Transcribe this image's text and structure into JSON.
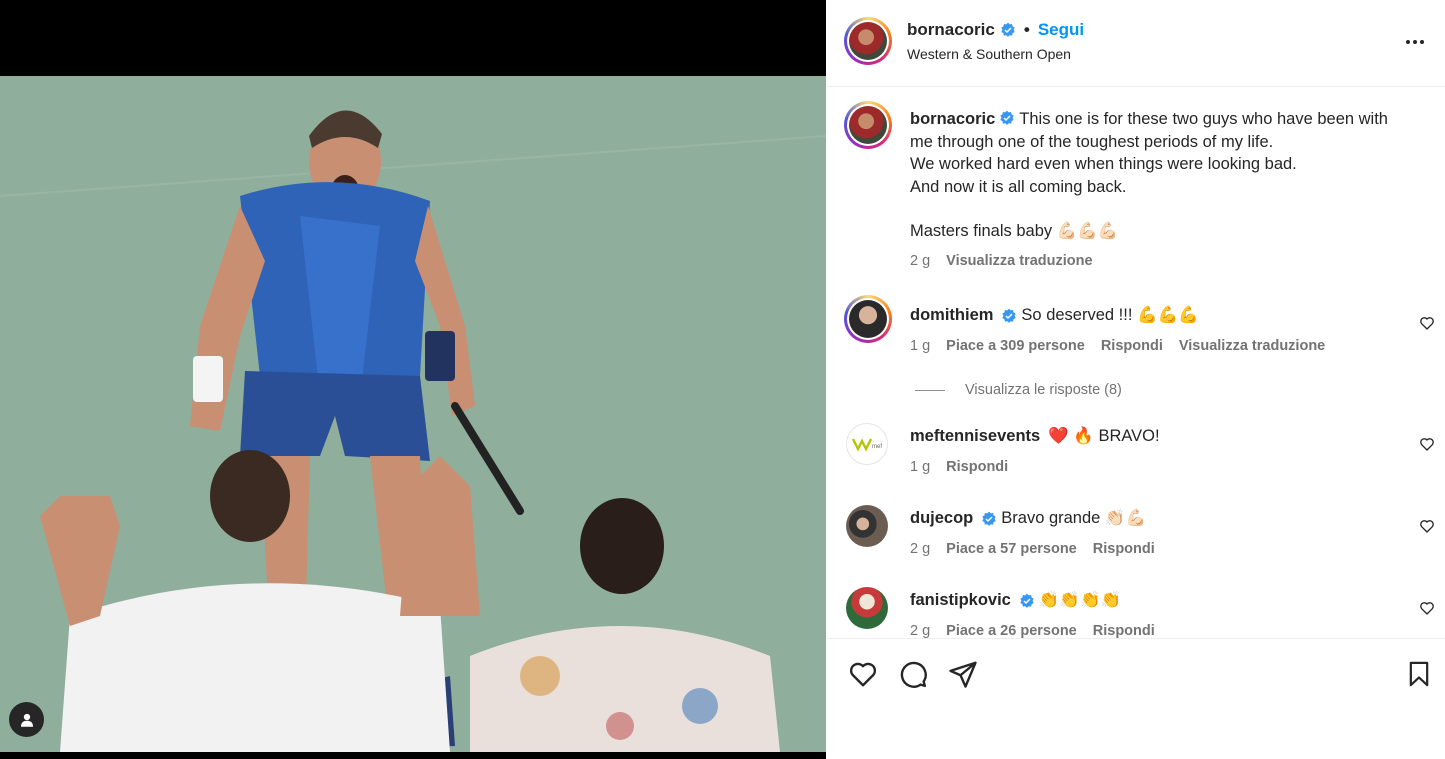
{
  "post": {
    "author": "bornacoric",
    "follow_label": "Segui",
    "separator": "•",
    "location": "Western & Southern Open"
  },
  "caption": {
    "username": "bornacoric",
    "line1": "This one is for these two guys who have been with",
    "line2": "me through one of the toughest periods of my life.",
    "line3": "We worked hard even when things were looking bad.",
    "line4": "And now it is all coming back.",
    "line5": "Masters finals baby 💪🏻💪🏻💪🏻",
    "time": "2 g",
    "translate_label": "Visualizza traduzione"
  },
  "comments": [
    {
      "username": "domithiem",
      "text": "So deserved !!! 💪💪💪",
      "time": "1 g",
      "likes": "Piace a 309 persone",
      "reply_label": "Rispondi",
      "translate_label": "Visualizza traduzione",
      "view_replies": "Visualizza le risposte (8)"
    },
    {
      "username": "meftennisevents",
      "text": "❤️ 🔥 BRAVO!",
      "time": "1 g",
      "reply_label": "Rispondi"
    },
    {
      "username": "dujecop",
      "text": "Bravo grande 👏🏻💪🏻",
      "time": "2 g",
      "likes": "Piace a 57 persone",
      "reply_label": "Rispondi"
    },
    {
      "username": "fanistipkovic",
      "text": "👏👏👏👏",
      "time": "2 g",
      "likes": "Piace a 26 persone",
      "reply_label": "Rispondi"
    }
  ],
  "icons": {
    "more": "more-horizontal-icon",
    "like": "heart-icon",
    "comment": "comment-icon",
    "share": "share-icon",
    "save": "bookmark-icon",
    "user_tag": "user-tag-icon",
    "verified": "verified-badge-icon"
  },
  "colors": {
    "accent": "#0095f6",
    "verified": "#3897f0",
    "text": "#262626",
    "muted": "#737373"
  }
}
